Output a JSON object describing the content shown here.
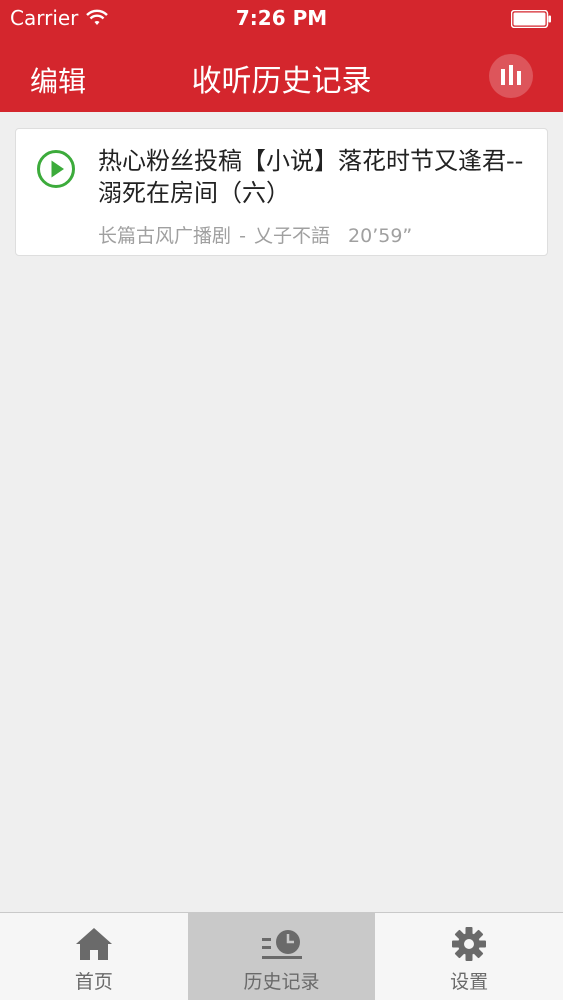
{
  "status_bar": {
    "carrier": "Carrier",
    "time": "7:26 PM"
  },
  "nav": {
    "edit_label": "编辑",
    "title": "收听历史记录",
    "right_icon": "equalizer-icon"
  },
  "history": {
    "items": [
      {
        "title": "热心粉丝投稿【小说】落花时节又逢君--溺死在房间（六）",
        "category": "长篇古风广播剧",
        "separator": "-",
        "author": "乂子不語",
        "duration": "20’59”",
        "icon": "play-circle-icon"
      }
    ]
  },
  "tabs": [
    {
      "label": "首页",
      "icon": "home-icon",
      "active": false
    },
    {
      "label": "历史记录",
      "icon": "history-icon",
      "active": true
    },
    {
      "label": "设置",
      "icon": "gear-icon",
      "active": false
    }
  ],
  "colors": {
    "brand_red": "#d4262d",
    "play_green": "#3cab3b",
    "tab_active_bg": "#c9c9c9",
    "page_bg": "#efefef"
  }
}
